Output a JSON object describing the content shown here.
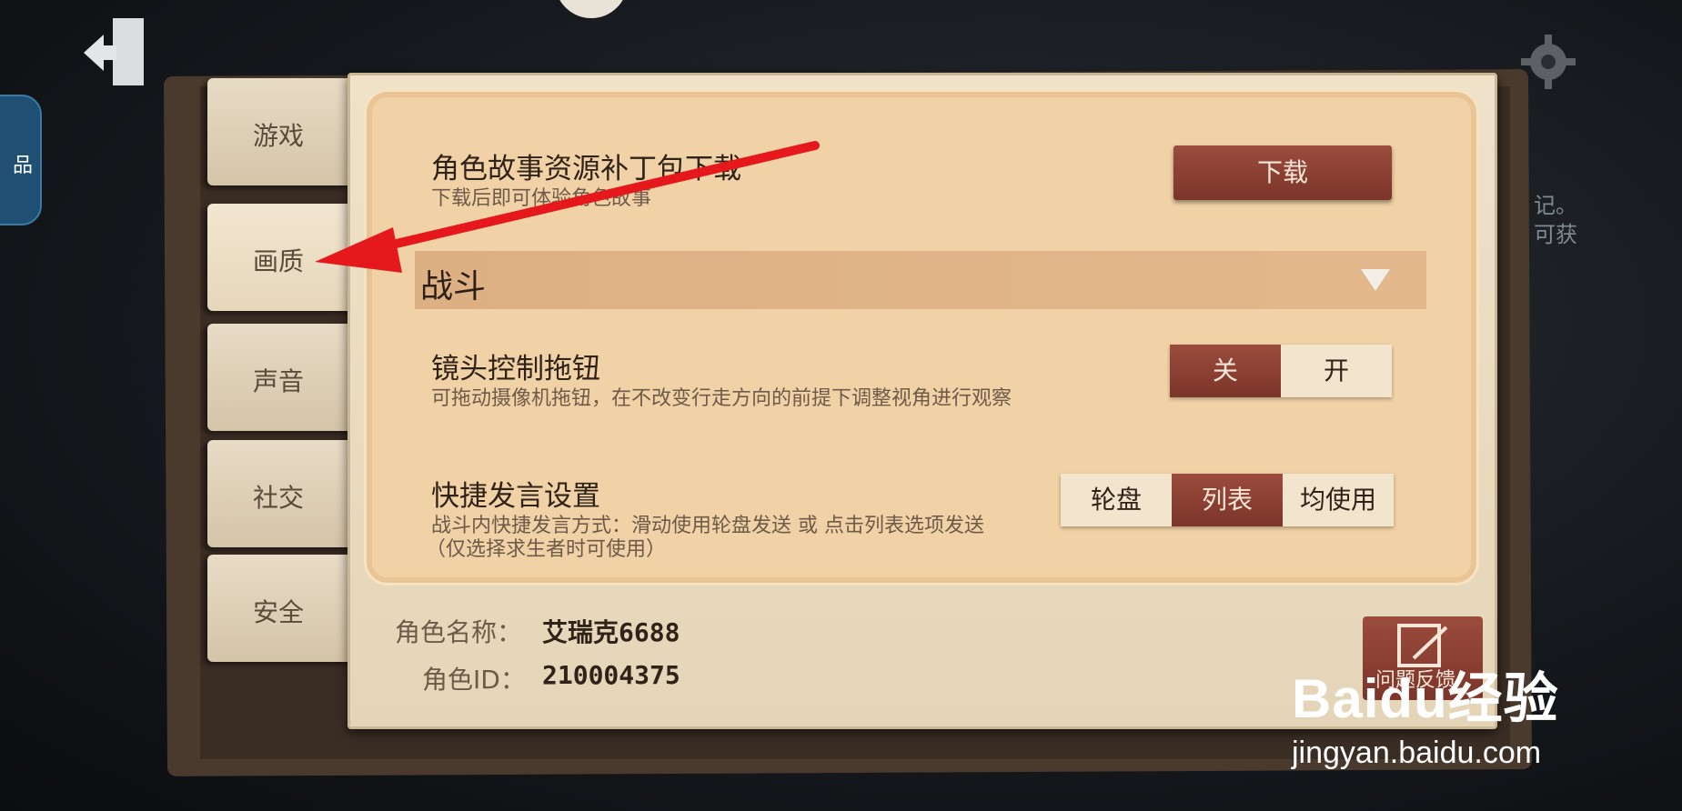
{
  "tabs": [
    {
      "label": "游戏"
    },
    {
      "label": "画质"
    },
    {
      "label": "声音"
    },
    {
      "label": "社交"
    },
    {
      "label": "安全"
    }
  ],
  "left_pill": {
    "label": "品"
  },
  "right_edge_text": [
    "记。",
    "可获"
  ],
  "story_patch": {
    "title": "角色故事资源补丁包下载",
    "desc": "下载后即可体验角色故事",
    "button": "下载"
  },
  "section": {
    "title": "战斗"
  },
  "camera_knob": {
    "title": "镜头控制拖钮",
    "desc": "可拖动摄像机拖钮，在不改变行走方向的前提下调整视角进行观察",
    "options": [
      "关",
      "开"
    ],
    "selected": "关"
  },
  "quick_chat": {
    "title": "快捷发言设置",
    "desc1": "战斗内快捷发言方式：滑动使用轮盘发送 或 点击列表选项发送",
    "desc2": "（仅选择求生者时可使用）",
    "options": [
      "轮盘",
      "列表",
      "均使用"
    ],
    "selected": "列表"
  },
  "profile": {
    "name_label": "角色名称：",
    "name_value": "艾瑞克6688",
    "id_label": "角色ID：",
    "id_value": "210004375"
  },
  "feedback": {
    "label": "问题反馈"
  },
  "watermark": {
    "top": "Baidu经验",
    "bottom": "jingyan.baidu.com"
  },
  "colors": {
    "accent": "#7b3529",
    "paper": "#f1d2a6",
    "annotation_arrow": "#e5191b"
  }
}
